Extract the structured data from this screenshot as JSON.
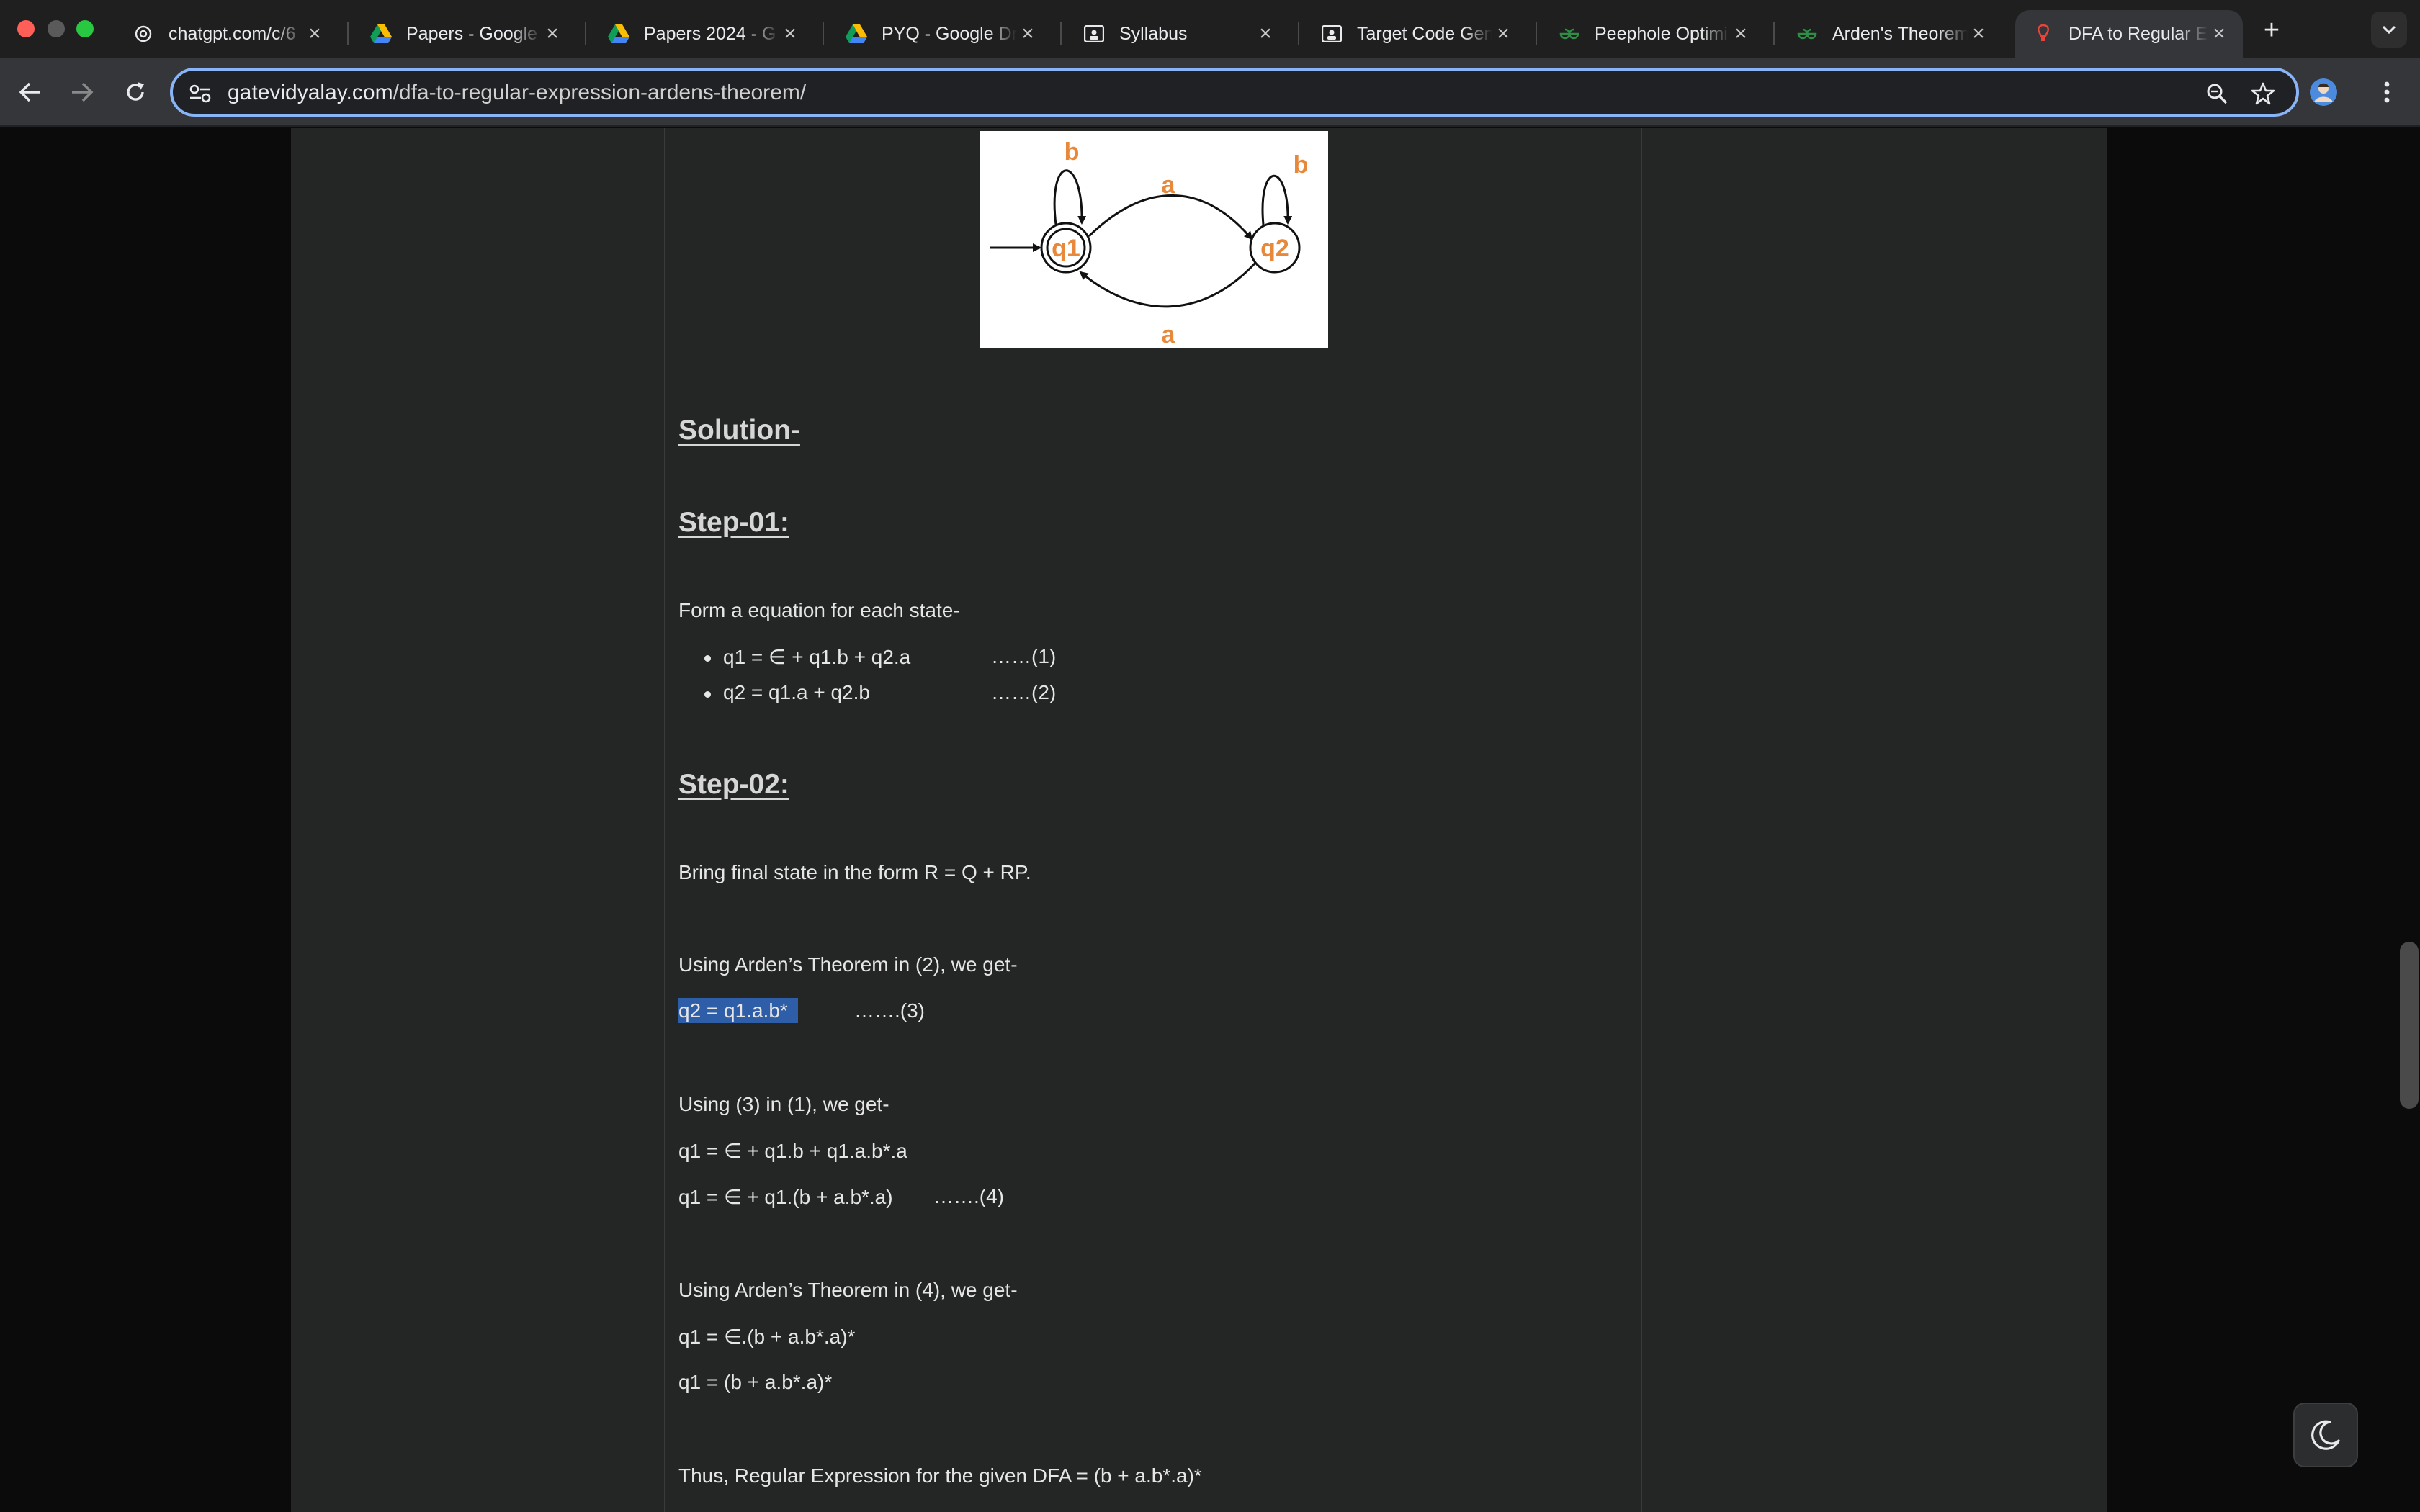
{
  "tabs": [
    {
      "title": "chatgpt.com/c/6",
      "icon": "chatgpt-icon"
    },
    {
      "title": "Papers - Google",
      "icon": "google-drive-icon"
    },
    {
      "title": "Papers 2024 - G",
      "icon": "google-drive-icon"
    },
    {
      "title": "PYQ - Google Dr",
      "icon": "google-drive-icon"
    },
    {
      "title": "Syllabus",
      "icon": "classroom-icon"
    },
    {
      "title": "Target Code Gen",
      "icon": "classroom-icon"
    },
    {
      "title": "Peephole Optimi",
      "icon": "geeksforgeeks-icon"
    },
    {
      "title": "Arden's Theorem",
      "icon": "geeksforgeeks-icon"
    },
    {
      "title": "DFA to Regular E",
      "icon": "gatevidyalay-icon",
      "active": true
    }
  ],
  "address_bar": {
    "domain": "gatevidyalay.com",
    "path": "/dfa-to-regular-expression-ardens-theorem/"
  },
  "figure": {
    "states": [
      "q1",
      "q2"
    ],
    "labels": {
      "self_loop_q1": "b",
      "self_loop_q2": "b",
      "q1_to_q2": "a",
      "q2_to_q1": "a"
    }
  },
  "article": {
    "solution_heading": "Solution-",
    "step1_heading": "Step-01:",
    "step1_intro": "Form a equation for each state-",
    "step1_bullets": [
      {
        "eq": "q1 = ∈ + q1.b + q2.a",
        "num": "……(1)"
      },
      {
        "eq": "q2 = q1.a + q2.b",
        "num": "……(2)"
      }
    ],
    "step2_heading": "Step-02:",
    "step2_intro": "Bring final state in the form R = Q + RP.",
    "arden_on_2": "Using Arden’s Theorem in (2), we get-",
    "eq3": "q2 = q1.a.b*",
    "eq3_num": "…….(3)",
    "using_3_in_1": "Using (3) in (1), we get-",
    "eq_a": "q1 = ∈ + q1.b + q1.a.b*.a",
    "eq4": "q1 = ∈ + q1.(b + a.b*.a)",
    "eq4_num": "…….(4)",
    "arden_on_4": "Using Arden’s Theorem in (4), we get-",
    "eq_b": "q1 = ∈.(b + a.b*.a)*",
    "eq_c": "q1 = (b + a.b*.a)*",
    "conclusion": "Thus, Regular Expression for the given DFA = (b + a.b*.a)*"
  },
  "colors": {
    "accent": "#8ab4f8",
    "dfa_label": "#e8883a",
    "selection": "#2f5ea8",
    "traffic_red": "#ff5f57",
    "traffic_yellow": "#febc2e",
    "traffic_green": "#28c840"
  }
}
